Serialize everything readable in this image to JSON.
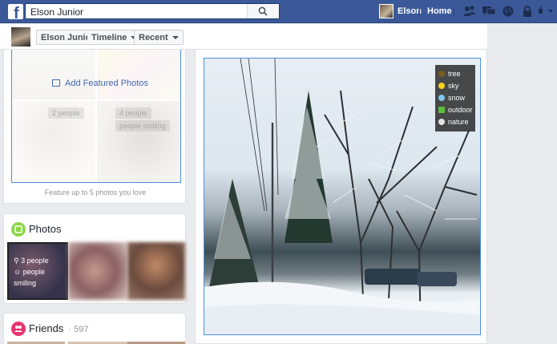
{
  "topbar": {
    "logo": "f",
    "search_value": "Elson Junior",
    "user_name": "Elson",
    "home_label": "Home",
    "icons": [
      "friend-requests-icon",
      "messages-icon",
      "notifications-icon",
      "privacy-icon",
      "account-menu-icon"
    ]
  },
  "subbar": {
    "breadcrumbs": [
      {
        "label": "Elson Junior"
      },
      {
        "label": "Timeline"
      },
      {
        "label": "Recent"
      }
    ]
  },
  "featured": {
    "add_label": "Add Featured Photos",
    "tile_tags": [
      "2 people",
      "4 people",
      "people smiling"
    ],
    "caption": "Feature up to 5 photos you love"
  },
  "photos": {
    "title": "Photos",
    "tags": [
      "3 people",
      "people",
      "smiling"
    ]
  },
  "friends": {
    "title": "Friends",
    "count": "597"
  },
  "post": {
    "image_alt_tags": [
      {
        "label": "tree",
        "icon": "tree-icon"
      },
      {
        "label": "sky",
        "icon": "sun-icon"
      },
      {
        "label": "snow",
        "icon": "snowflake-icon"
      },
      {
        "label": "outdoor",
        "icon": "outdoor-icon"
      },
      {
        "label": "nature",
        "icon": "nature-icon"
      }
    ]
  },
  "colors": {
    "brand_blue": "#3b5998",
    "link_blue": "#4267b2",
    "photos_green": "#8ed64a",
    "friends_pink": "#e7356f"
  }
}
